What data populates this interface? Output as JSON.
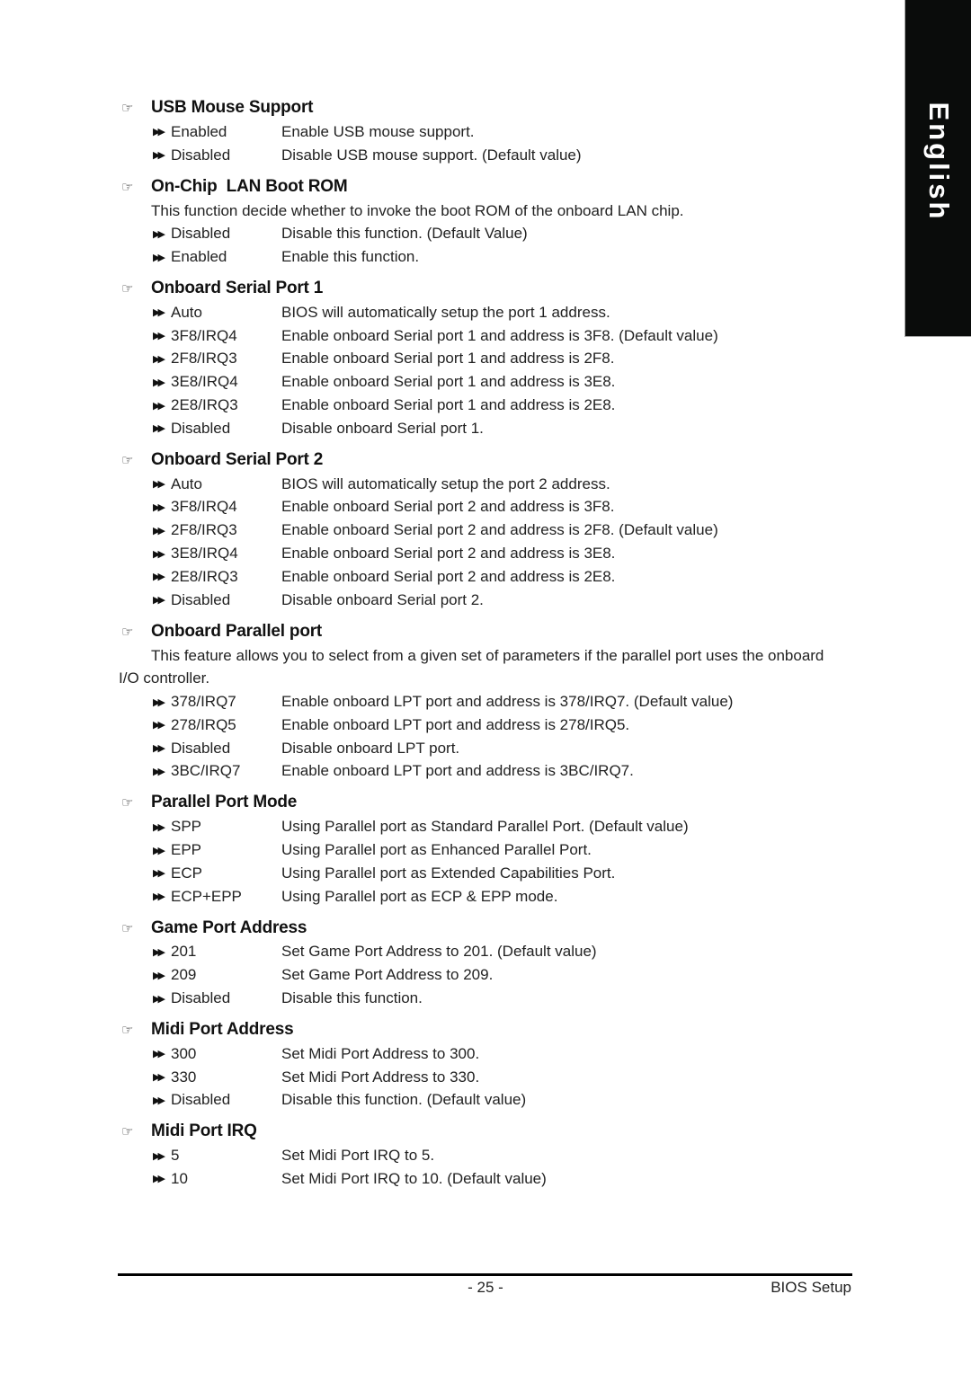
{
  "side_tab": {
    "label": "English"
  },
  "sections": [
    {
      "title": "USB Mouse Support",
      "description": null,
      "options": [
        {
          "name": "Enabled",
          "desc": "Enable USB mouse support."
        },
        {
          "name": "Disabled",
          "desc": "Disable USB mouse support. (Default value)"
        }
      ]
    },
    {
      "title": "On-Chip  LAN Boot ROM",
      "description": "This function decide whether to invoke the boot ROM of the onboard LAN chip.",
      "options": [
        {
          "name": "Disabled",
          "desc": "Disable this function. (Default Value)"
        },
        {
          "name": "Enabled",
          "desc": "Enable this function."
        }
      ]
    },
    {
      "title": "Onboard Serial Port 1",
      "description": null,
      "options": [
        {
          "name": "Auto",
          "desc": "BIOS will automatically setup the port 1 address."
        },
        {
          "name": "3F8/IRQ4",
          "desc": "Enable onboard Serial port 1 and address is 3F8. (Default value)"
        },
        {
          "name": "2F8/IRQ3",
          "desc": "Enable onboard Serial port 1 and address is 2F8."
        },
        {
          "name": "3E8/IRQ4",
          "desc": "Enable onboard Serial port 1 and address is 3E8."
        },
        {
          "name": "2E8/IRQ3",
          "desc": "Enable onboard Serial port 1 and address is 2E8."
        },
        {
          "name": "Disabled",
          "desc": "Disable onboard Serial port 1."
        }
      ]
    },
    {
      "title": "Onboard Serial Port 2",
      "description": null,
      "options": [
        {
          "name": "Auto",
          "desc": "BIOS will automatically setup the port 2 address."
        },
        {
          "name": "3F8/IRQ4",
          "desc": "Enable onboard Serial port 2 and address is 3F8."
        },
        {
          "name": "2F8/IRQ3",
          "desc": "Enable onboard Serial port 2 and address is 2F8. (Default value)"
        },
        {
          "name": "3E8/IRQ4",
          "desc": "Enable onboard Serial port 2 and address is 3E8."
        },
        {
          "name": "2E8/IRQ3",
          "desc": "Enable onboard Serial port 2 and address is 2E8."
        },
        {
          "name": "Disabled",
          "desc": "Disable onboard Serial port 2."
        }
      ]
    },
    {
      "title": "Onboard Parallel port",
      "description_line1": "This feature allows you to select from a given set of parameters if the parallel port uses the onboard",
      "description_line2": "I/O controller.",
      "options": [
        {
          "name": "378/IRQ7",
          "desc": "Enable onboard LPT port and address is 378/IRQ7. (Default value)"
        },
        {
          "name": "278/IRQ5",
          "desc": "Enable onboard LPT port and address is 278/IRQ5."
        },
        {
          "name": "Disabled",
          "desc": "Disable onboard LPT port."
        },
        {
          "name": "3BC/IRQ7",
          "desc": "Enable onboard LPT port and address is 3BC/IRQ7."
        }
      ]
    },
    {
      "title": "Parallel Port Mode",
      "description": null,
      "options": [
        {
          "name": "SPP",
          "desc": "Using Parallel port as Standard Parallel Port. (Default value)"
        },
        {
          "name": "EPP",
          "desc": "Using Parallel port as Enhanced Parallel Port."
        },
        {
          "name": "ECP",
          "desc": "Using Parallel port as Extended Capabilities Port."
        },
        {
          "name": "ECP+EPP",
          "desc": "Using Parallel port as ECP & EPP mode."
        }
      ]
    },
    {
      "title": "Game Port Address",
      "description": null,
      "options": [
        {
          "name": "201",
          "desc": "Set Game Port Address to 201. (Default value)"
        },
        {
          "name": "209",
          "desc": "Set Game Port Address to 209."
        },
        {
          "name": "Disabled",
          "desc": "Disable this function."
        }
      ]
    },
    {
      "title": "Midi Port Address",
      "description": null,
      "options": [
        {
          "name": "300",
          "desc": "Set Midi Port Address to 300."
        },
        {
          "name": "330",
          "desc": "Set Midi Port Address to 330."
        },
        {
          "name": "Disabled",
          "desc": "Disable this function. (Default value)"
        }
      ]
    },
    {
      "title": "Midi Port IRQ",
      "description": null,
      "options": [
        {
          "name": "5",
          "desc": "Set Midi Port IRQ to 5."
        },
        {
          "name": "10",
          "desc": "Set Midi Port IRQ to 10. (Default value)"
        }
      ]
    }
  ],
  "icons": {
    "heading": "pointing-hand-icon",
    "option": "double-arrow-icon"
  },
  "glyphs": {
    "hand": "☞",
    "arrow": "▶▶"
  },
  "footer": {
    "page_number": "- 25 -",
    "title": "BIOS Setup"
  }
}
